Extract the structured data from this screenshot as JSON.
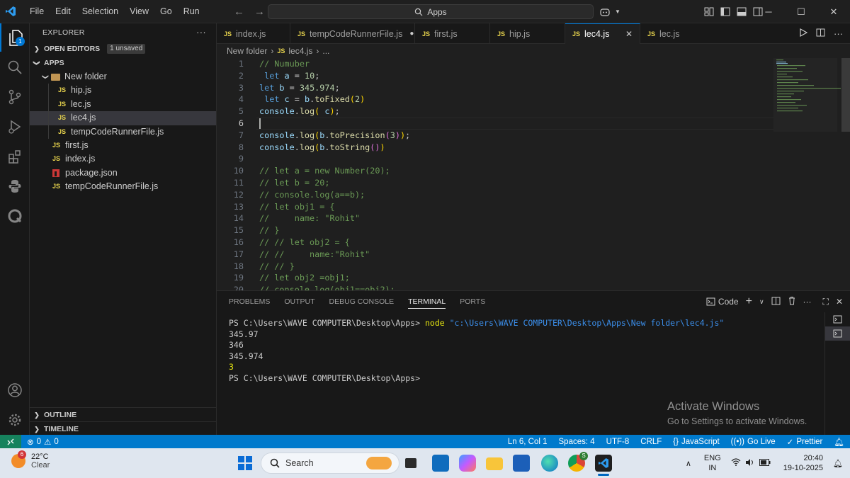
{
  "titlebar": {
    "menu": [
      "File",
      "Edit",
      "Selection",
      "View",
      "Go",
      "Run"
    ],
    "search_text": "Apps"
  },
  "explorer": {
    "title": "EXPLORER",
    "open_editors": "OPEN EDITORS",
    "unsaved_badge": "1 unsaved",
    "root": "APPS",
    "folder": "New folder",
    "folder_files": [
      "hip.js",
      "lec.js",
      "lec4.js",
      "tempCodeRunnerFile.js"
    ],
    "root_files": [
      "first.js",
      "index.js",
      "package.json",
      "tempCodeRunnerFile.js"
    ],
    "js_badge": "JS",
    "outline": "OUTLINE",
    "timeline": "TIMELINE"
  },
  "activity": {
    "explorer_badge": "1"
  },
  "tabs": [
    {
      "label": "index.js"
    },
    {
      "label": "tempCodeRunnerFile.js"
    },
    {
      "label": "first.js"
    },
    {
      "label": "hip.js"
    },
    {
      "label": "lec4.js"
    },
    {
      "label": "lec.js"
    }
  ],
  "breadcrumb": {
    "folder": "New folder",
    "file": "lec4.js",
    "more": "..."
  },
  "code_lines": [
    {
      "n": "1",
      "t": "// Numuber"
    },
    {
      "n": "2",
      "t": " let a = 10;"
    },
    {
      "n": "3",
      "t": "let b = 345.974;"
    },
    {
      "n": "4",
      "t": " let c = b.toFixed(2)"
    },
    {
      "n": "5",
      "t": "console.log( c);"
    },
    {
      "n": "6",
      "t": ""
    },
    {
      "n": "7",
      "t": "console.log(b.toPrecision(3));"
    },
    {
      "n": "8",
      "t": "console.log(b.toString())"
    },
    {
      "n": "9",
      "t": ""
    },
    {
      "n": "10",
      "t": "// let a = new Number(20);"
    },
    {
      "n": "11",
      "t": "// let b = 20;"
    },
    {
      "n": "12",
      "t": "// console.log(a==b);"
    },
    {
      "n": "13",
      "t": "// let obj1 = {"
    },
    {
      "n": "14",
      "t": "//     name: \"Rohit\""
    },
    {
      "n": "15",
      "t": "// }"
    },
    {
      "n": "16",
      "t": "// // let obj2 = {"
    },
    {
      "n": "17",
      "t": "// //     name:\"Rohit\""
    },
    {
      "n": "18",
      "t": "// // }"
    },
    {
      "n": "19",
      "t": "// let obj2 =obj1;"
    },
    {
      "n": "20",
      "t": "// console.log(obj1==obj2);"
    }
  ],
  "panel": {
    "tabs": [
      "PROBLEMS",
      "OUTPUT",
      "DEBUG CONSOLE",
      "TERMINAL",
      "PORTS"
    ],
    "active_tab": "TERMINAL",
    "shell_label": "Code",
    "prompt": "PS C:\\Users\\WAVE COMPUTER\\Desktop\\Apps>",
    "command": "node",
    "argument": "\"c:\\Users\\WAVE COMPUTER\\Desktop\\Apps\\New folder\\lec4.js\"",
    "output": [
      "345.97",
      "346",
      "345.974",
      "3"
    ],
    "final_prompt": "PS C:\\Users\\WAVE COMPUTER\\Desktop\\Apps>"
  },
  "watermark": {
    "title": "Activate Windows",
    "subtitle": "Go to Settings to activate Windows."
  },
  "status": {
    "errors": "0",
    "warnings": "0",
    "position": "Ln 6, Col 1",
    "spaces": "Spaces: 4",
    "encoding": "UTF-8",
    "eol": "CRLF",
    "language": "JavaScript",
    "golive": "Go Live",
    "prettier": "Prettier"
  },
  "taskbar": {
    "weather_badge": "6",
    "temp": "22°C",
    "condition": "Clear",
    "search": "Search",
    "chrome_badge": "S",
    "lang": "ENG",
    "region": "IN",
    "time": "20:40",
    "date": "19-10-2025"
  },
  "colors": {
    "accent": "#0078d4",
    "statusbar": "#007acc",
    "js_yellow": "#e8d44d",
    "comment": "#6a9955"
  }
}
